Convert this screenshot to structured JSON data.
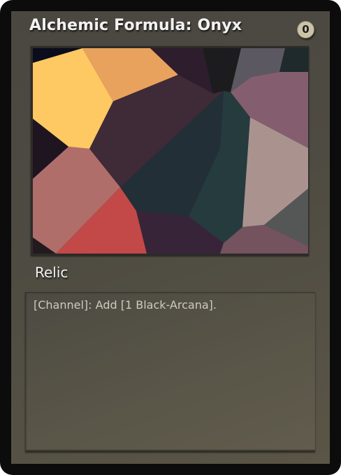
{
  "card": {
    "title": "Alchemic Formula: Onyx",
    "cost": "0",
    "type_line": "Relic",
    "rules_text": "[Channel]: Add [1 Black-Arcana].",
    "art_icon": "voronoi-mosaic-art",
    "colors": {
      "border": "#0c0c0c",
      "frame": "#4e4b42",
      "text_box": "#5a5648",
      "cost_badge": "#cbc3a7",
      "title_text": "#f2f2f2"
    }
  }
}
